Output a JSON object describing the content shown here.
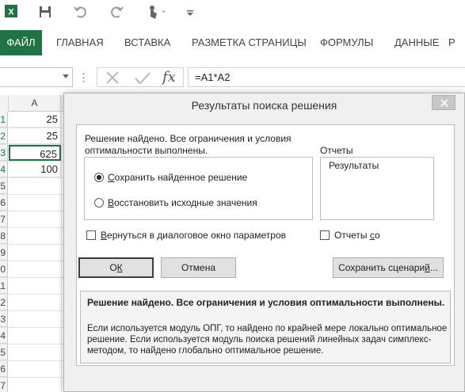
{
  "app": {
    "logo_letter": "X",
    "brand_color": "#217346"
  },
  "quick_access": {
    "icons": [
      "excel-logo-icon",
      "save-icon",
      "undo-icon",
      "redo-icon",
      "touch-mode-icon",
      "customize-qat-icon"
    ]
  },
  "ribbon": {
    "tabs": [
      "ФАЙЛ",
      "ГЛАВНАЯ",
      "ВСТАВКА",
      "РАЗМЕТКА СТРАНИЦЫ",
      "ФОРМУЛЫ",
      "ДАННЫЕ",
      "Р"
    ]
  },
  "formula_bar": {
    "name_box": "",
    "fx_label": "fx",
    "formula": "=A1*A2"
  },
  "grid": {
    "column_header": "A",
    "row_numbers": [
      "1",
      "2",
      "3",
      "4",
      "5",
      "6",
      "7",
      "8",
      "9",
      "10",
      "11",
      "12",
      "13",
      "14",
      "15",
      "16",
      "17"
    ],
    "cells": [
      "25",
      "25",
      "625",
      "100"
    ]
  },
  "dialog": {
    "title": "Результаты поиска решения",
    "message": "Решение найдено. Все ограничения и условия оптимальности выполнены.",
    "reports_label": "Отчеты",
    "reports_items": [
      "Результаты"
    ],
    "options": [
      {
        "pre": "",
        "key": "С",
        "post": "охранить найденное решение",
        "selected": true
      },
      {
        "pre": "",
        "key": "В",
        "post": "осстановить исходные значения",
        "selected": false
      }
    ],
    "return_checkbox": {
      "pre": "",
      "key": "В",
      "post": "ернуться в диалоговое окно параметров",
      "checked": false
    },
    "outline_checkbox": {
      "pre": "Отчеты ",
      "key": "с",
      "post": "о",
      "checked": false
    },
    "buttons": {
      "ok": {
        "pre": "О",
        "key": "К",
        "post": ""
      },
      "cancel": "Отмена",
      "save_scenario": {
        "pre": "Сохранить сценари",
        "key": "й",
        "post": "..."
      }
    },
    "info_title": "Решение найдено. Все ограничения и условия оптимальности выполнены.",
    "info_body": "Если используется модуль ОПГ, то найдено по крайней мере локально оптимальное решение. Если используется модуль поиска решений линейных задач симплекс-методом, то найдено глобально оптимальное решение."
  }
}
